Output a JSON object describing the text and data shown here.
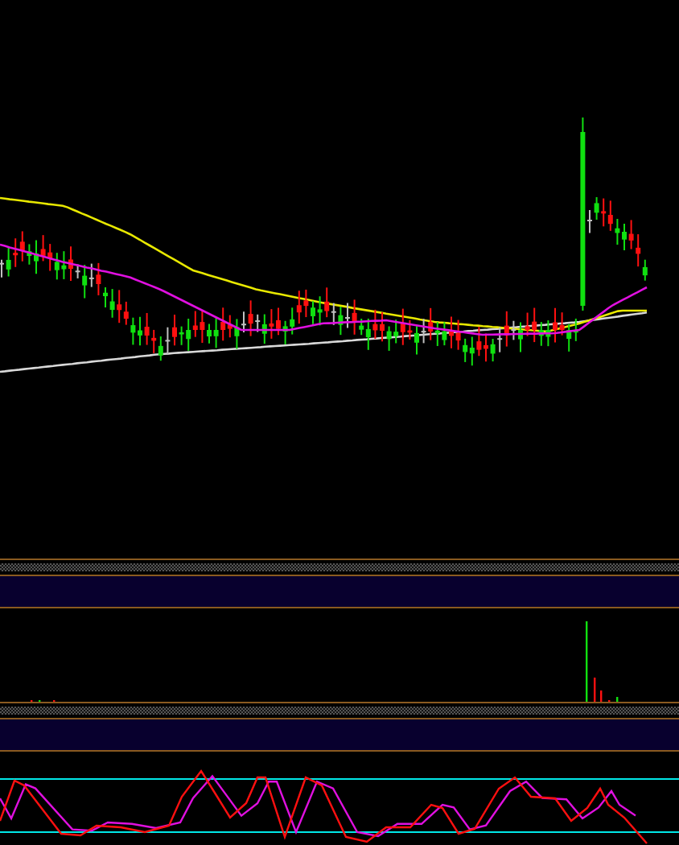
{
  "panels": [
    {
      "kind": "candles"
    },
    {
      "kind": "separator"
    },
    {
      "kind": "volume"
    },
    {
      "kind": "separator"
    },
    {
      "kind": "oscillator"
    }
  ]
}
